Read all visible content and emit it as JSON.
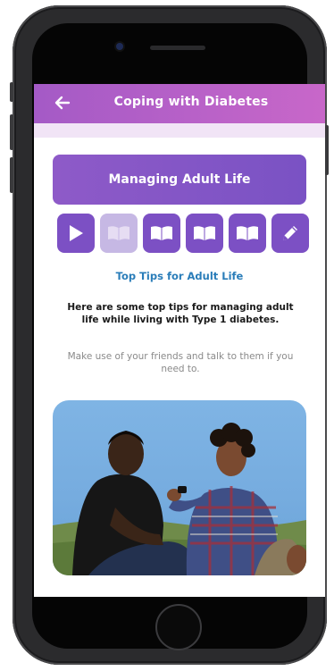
{
  "header": {
    "title": "Coping with Diabetes",
    "back_icon": "arrow-left-icon",
    "gradient": [
      "#a45ac6",
      "#c867c9"
    ]
  },
  "section": {
    "title": "Managing Adult Life",
    "color": "#8e5ac8"
  },
  "steps": [
    {
      "icon": "play-icon",
      "state": "default"
    },
    {
      "icon": "book-icon",
      "state": "current"
    },
    {
      "icon": "book-icon",
      "state": "default"
    },
    {
      "icon": "book-icon",
      "state": "default"
    },
    {
      "icon": "book-icon",
      "state": "default"
    },
    {
      "icon": "pencil-icon",
      "state": "default"
    }
  ],
  "content": {
    "subtitle": "Top Tips for Adult Life",
    "intro": "Here are some top tips for managing adult life while living with Type 1 diabetes.",
    "tip": "Make use of your friends and talk to them if you need to.",
    "photo_description": "Two young men sitting on grass talking, one holding a glucose meter"
  },
  "colors": {
    "step_active_bg": "#c6b8e4",
    "step_bg": "#7c50c4",
    "subtitle": "#2a7db9"
  }
}
